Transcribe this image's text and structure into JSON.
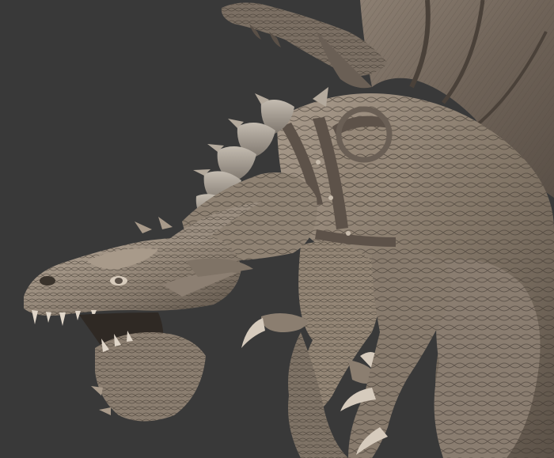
{
  "scene": {
    "subject": "dragon-sculpt",
    "colors": {
      "background": "#393939",
      "clay_light": "#b3a595",
      "clay_mid": "#8a7d70",
      "clay_dark": "#4e443b",
      "clay_shadow": "#2e2823",
      "metal_plate": "#a39b91"
    }
  }
}
